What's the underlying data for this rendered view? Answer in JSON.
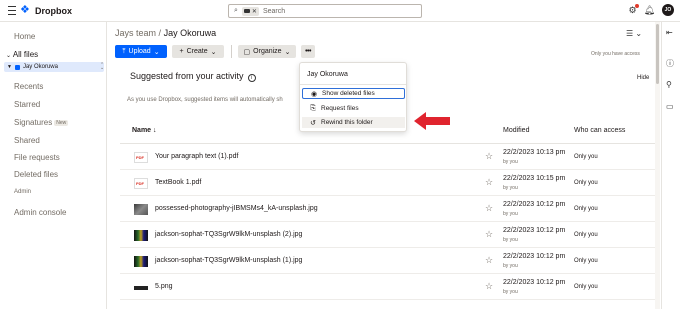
{
  "app": {
    "brand": "Dropbox"
  },
  "search": {
    "placeholder": "Search"
  },
  "topbar": {
    "avatar_initials": "JO"
  },
  "sidebar": {
    "home": "Home",
    "all_files": "All files",
    "team_folder": "Jay Okoruwa",
    "recents": "Recents",
    "starred": "Starred",
    "signatures": "Signatures",
    "signatures_badge": "New",
    "shared": "Shared",
    "file_requests": "File requests",
    "deleted_files": "Deleted files",
    "admin": "Admin",
    "admin_console": "Admin console"
  },
  "breadcrumb": {
    "parent": "Jays team",
    "separator": "/",
    "current": "Jay Okoruwa"
  },
  "toolbar": {
    "upload": "Upload",
    "create": "Create",
    "organize": "Organize",
    "more": "•••",
    "access_note": "Only you have access"
  },
  "suggested": {
    "title": "Suggested from your activity",
    "hide": "Hide",
    "description": "As you use Dropbox, suggested items will automatically sh"
  },
  "list": {
    "col_name": "Name",
    "col_modified": "Modified",
    "col_who": "Who can access",
    "rows": [
      {
        "name": "Your paragraph text (1).pdf",
        "date": "22/2/2023 10:13 pm",
        "by": "by you",
        "who": "Only you",
        "thumb": "pdf"
      },
      {
        "name": "TextBook 1.pdf",
        "date": "22/2/2023 10:15 pm",
        "by": "by you",
        "who": "Only you",
        "thumb": "pdf"
      },
      {
        "name": "possessed-photography-jIBMSMs4_kA-unsplash.jpg",
        "date": "22/2/2023 10:12 pm",
        "by": "by you",
        "who": "Only you",
        "thumb": "photo"
      },
      {
        "name": "jackson-sophat-TQ3SgrW9lkM-unsplash (2).jpg",
        "date": "22/2/2023 10:12 pm",
        "by": "by you",
        "who": "Only you",
        "thumb": "dark"
      },
      {
        "name": "jackson-sophat-TQ3SgrW9lkM-unsplash (1).jpg",
        "date": "22/2/2023 10:12 pm",
        "by": "by you",
        "who": "Only you",
        "thumb": "dark"
      },
      {
        "name": "5.png",
        "date": "22/2/2023 10:12 pm",
        "by": "by you",
        "who": "Only you",
        "thumb": "png"
      }
    ]
  },
  "dropdown": {
    "title": "Jay Okoruwa",
    "items": [
      {
        "label": "Show deleted files",
        "icon": "eye-icon"
      },
      {
        "label": "Request files",
        "icon": "request-icon"
      },
      {
        "label": "Rewind this folder",
        "icon": "rewind-icon"
      }
    ]
  },
  "colors": {
    "accent": "#0061fe",
    "annotation_arrow": "#e0242e",
    "focus_ring": "#2f6fd8"
  }
}
